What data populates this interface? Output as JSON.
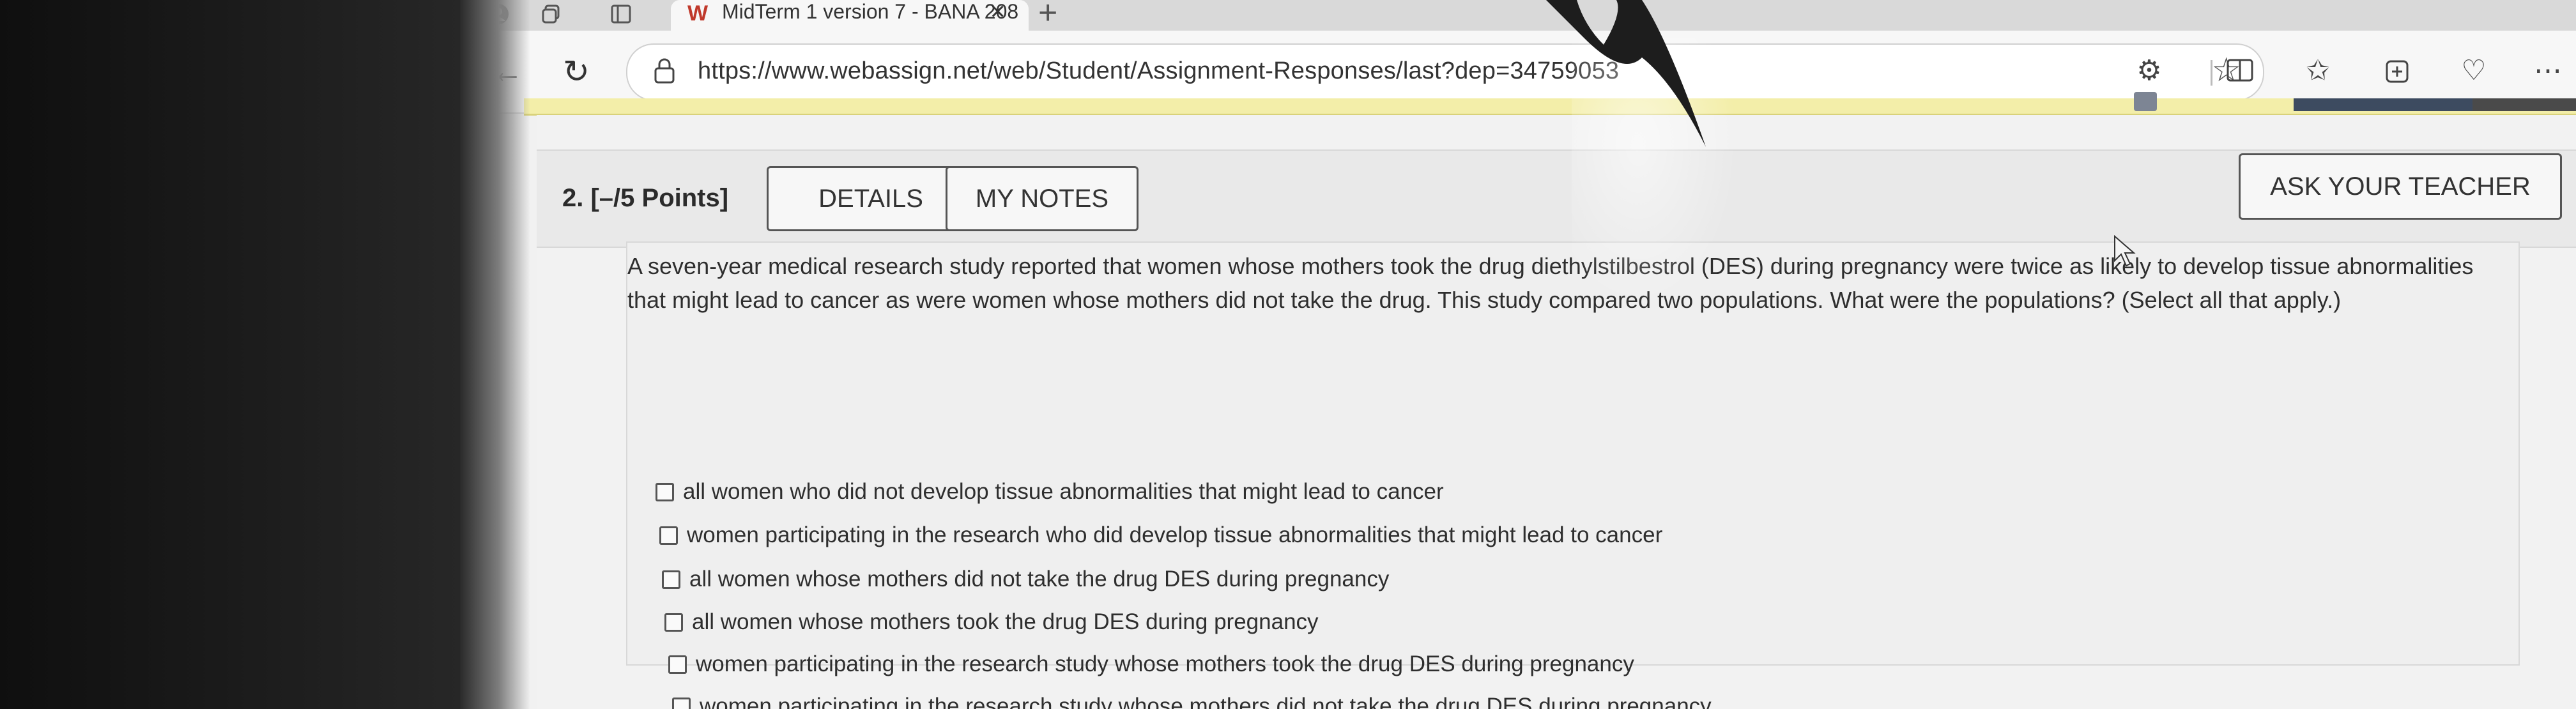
{
  "browser": {
    "tab_title": "MidTerm 1 version 7 - BANA 208",
    "url": "https://www.webassign.net/web/Student/Assignment-Responses/last?dep=34759053",
    "icons": [
      "profile-icon",
      "workspaces-icon",
      "tab-actions-icon",
      "webassign-favicon",
      "close-tab-icon",
      "new-tab-icon",
      "back-icon",
      "refresh-icon",
      "lock-icon",
      "favorite-star-icon",
      "extensions-icon",
      "split-screen-icon",
      "favorites-icon",
      "collections-icon",
      "browser-essentials-icon",
      "more-icon"
    ]
  },
  "question": {
    "label": "2.  [–/5 Points]",
    "details_label": "DETAILS",
    "notes_label": "MY NOTES",
    "ask_label": "ASK YOUR TEACHER",
    "text": "A seven-year medical research study reported that women whose mothers took the drug diethylstilbestrol (DES) during pregnancy were twice as likely to develop tissue abnormalities that might lead to cancer as were women whose mothers did not take the drug. This study compared two populations. What were the populations? (Select all that apply.)",
    "options": [
      "all women who did not develop tissue abnormalities that might lead to cancer",
      "women participating in the research who did develop tissue abnormalities that might lead to cancer",
      "all women whose mothers did not take the drug DES during pregnancy",
      "all women whose mothers took the drug DES during pregnancy",
      "women participating in the research study whose mothers took the drug DES during pregnancy",
      "women participating in the research study whose mothers did not take the drug DES during pregnancy"
    ]
  }
}
